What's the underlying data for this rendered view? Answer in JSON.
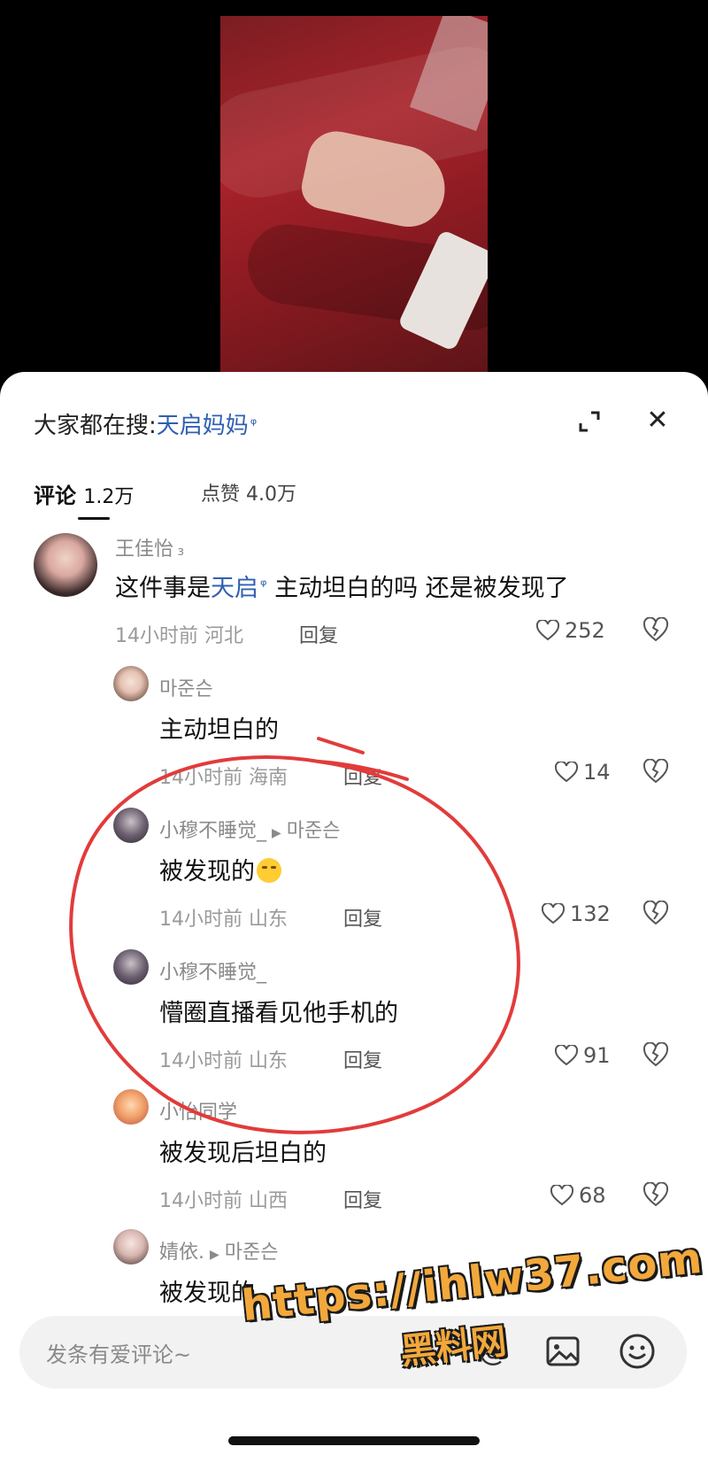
{
  "colors": {
    "accent_link": "#2f5fb3",
    "annotation_red": "#e23b3b",
    "watermark": "#f2a83b"
  },
  "search": {
    "prefix": "大家都在搜:",
    "keyword": "天启妈妈",
    "search_icon": "search-icon"
  },
  "tabs": {
    "comments_label": "评论",
    "comments_count": "1.2万",
    "likes_label": "点赞",
    "likes_count": "4.0万"
  },
  "comments": [
    {
      "user": "王佳怡",
      "text_before": "这件事是",
      "text_keyword": "天启",
      "text_after": "主动坦白的吗 还是被发现了",
      "time": "14小时前",
      "location": "河北",
      "reply": "回复",
      "likes": "252"
    },
    {
      "user": "마준슨",
      "text": "主动坦白的",
      "time": "14小时前",
      "location": "海南",
      "reply": "回复",
      "likes": "14"
    },
    {
      "user": "小穆不睡觉_",
      "reply_to": "마준슨",
      "text": "被发现的",
      "emoji": "crying-laughing-emoji",
      "time": "14小时前",
      "location": "山东",
      "reply": "回复",
      "likes": "132"
    },
    {
      "user": "小穆不睡觉_",
      "text": "懵圈直播看见他手机的",
      "time": "14小时前",
      "location": "山东",
      "reply": "回复",
      "likes": "91"
    },
    {
      "user": "小怡同学",
      "text": "被发现后坦白的",
      "time": "14小时前",
      "location": "山西",
      "reply": "回复",
      "likes": "68"
    },
    {
      "user": "婧依.",
      "reply_to": "마준슨",
      "text": "被发现的"
    }
  ],
  "input": {
    "placeholder": "发条有爱评论~"
  },
  "watermark": {
    "url": "https://ihlw37.com",
    "name": "黑料网"
  }
}
